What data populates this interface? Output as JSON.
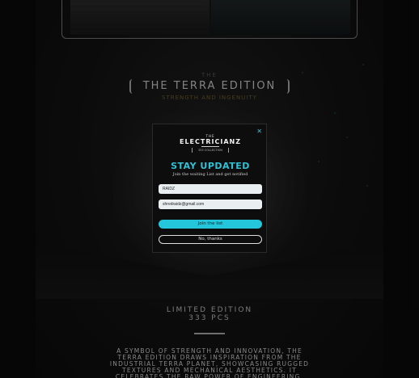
{
  "gallery": {
    "left_alt": "gallery image 1",
    "right_alt": "gallery image 2"
  },
  "edition": {
    "the": "THE",
    "title": "THE TERRA EDITION",
    "subtitle": "STRENGTH AND INGENUITY"
  },
  "limited": {
    "line1": "LIMITED EDITION",
    "line2": "333 PCS"
  },
  "description": "A SYMBOL OF STRENGTH AND INNOVATION, THE TERRA EDITION DRAWS INSPIRATION FROM THE INDUSTRIAL TERRA PLANET, SHOWCASING RUGGED TEXTURES AND MECHANICAL AESTHETICS. IT CELEBRATES THE RAW POWER OF ENGINEERING.",
  "modal": {
    "close": "✕",
    "logo_the": "THE",
    "logo": "ELECTRICIANZ",
    "logo_sub": "333 COLLECTION",
    "heading": "STAY UPDATED",
    "text": "Join the waiting List and get notified",
    "name_value": "RAIDZ",
    "email_value": "shredraidz@gmail.com",
    "join_label": "Join the list",
    "no_label": "No, thanks"
  },
  "colors": {
    "accent": "#2fc2d6",
    "background": "#0a0a0a"
  }
}
